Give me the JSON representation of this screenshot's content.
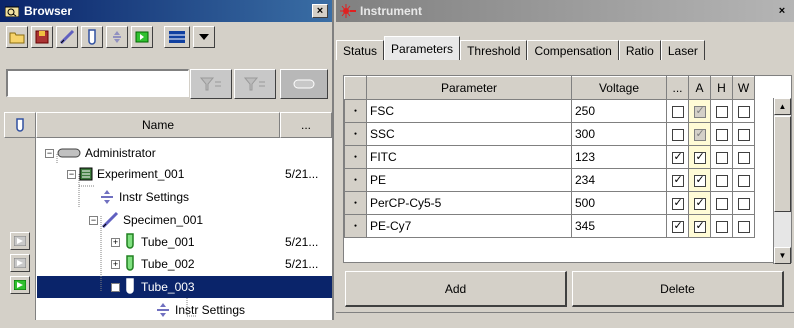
{
  "browser": {
    "title": "Browser",
    "close_label": "×",
    "filter_value": "",
    "columns": {
      "name": "Name",
      "more": "..."
    },
    "tree": [
      {
        "label": "Administrator",
        "date": ""
      },
      {
        "label": "Experiment_001",
        "date": "5/21..."
      },
      {
        "label": "Instr Settings",
        "date": ""
      },
      {
        "label": "Specimen_001",
        "date": ""
      },
      {
        "label": "Tube_001",
        "date": "5/21..."
      },
      {
        "label": "Tube_002",
        "date": "5/21..."
      },
      {
        "label": "Tube_003",
        "date": ""
      },
      {
        "label": "Instr Settings",
        "date": ""
      }
    ]
  },
  "instrument": {
    "title": "Instrument",
    "close_label": "×",
    "tabs": [
      "Status",
      "Parameters",
      "Threshold",
      "Compensation",
      "Ratio",
      "Laser"
    ],
    "active_tab": "Parameters",
    "columns": {
      "parameter": "Parameter",
      "voltage": "Voltage",
      "log": "...",
      "a": "A",
      "h": "H",
      "w": "W"
    },
    "rows": [
      {
        "parameter": "FSC",
        "voltage": "250",
        "log": false,
        "a": true,
        "a_gray": true,
        "h": false,
        "w": false
      },
      {
        "parameter": "SSC",
        "voltage": "300",
        "log": false,
        "a": true,
        "a_gray": true,
        "h": false,
        "w": false
      },
      {
        "parameter": "FITC",
        "voltage": "123",
        "log": true,
        "a": true,
        "a_gray": false,
        "h": false,
        "w": false
      },
      {
        "parameter": "PE",
        "voltage": "234",
        "log": true,
        "a": true,
        "a_gray": false,
        "h": false,
        "w": false
      },
      {
        "parameter": "PerCP-Cy5-5",
        "voltage": "500",
        "log": true,
        "a": true,
        "a_gray": false,
        "h": false,
        "w": false
      },
      {
        "parameter": "PE-Cy7",
        "voltage": "345",
        "log": true,
        "a": true,
        "a_gray": false,
        "h": false,
        "w": false
      }
    ],
    "add_label": "Add",
    "delete_label": "Delete"
  },
  "colors": {
    "selection": "#0a246a",
    "a_column": "#fffbd6",
    "face": "#d4d0c8"
  }
}
